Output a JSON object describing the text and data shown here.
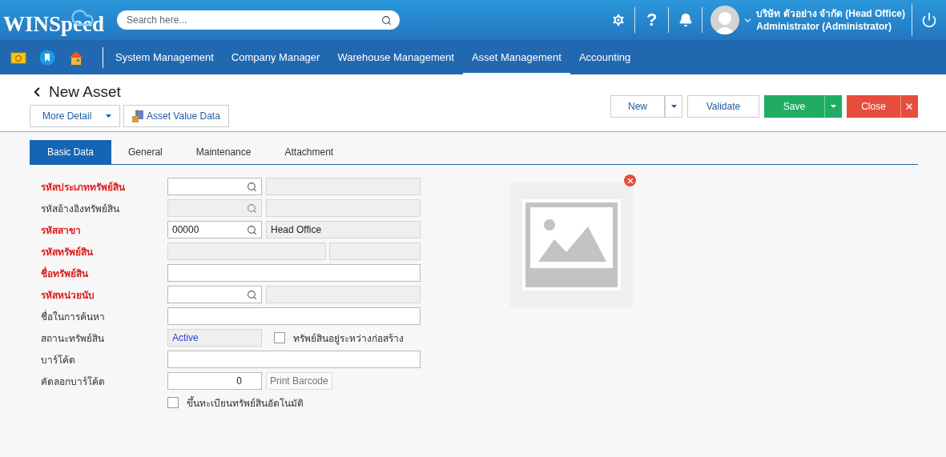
{
  "header": {
    "logo": "WINSpeed",
    "search": {
      "placeholder": "Search here..."
    },
    "help": "?",
    "company": "บริษัท ตัวอย่าง จำกัด (Head Office)",
    "user": "Administrator (Administrator)"
  },
  "menu": [
    {
      "label": "System Management",
      "selected": false
    },
    {
      "label": "Company Manager",
      "selected": false
    },
    {
      "label": "Warehouse Management",
      "selected": false
    },
    {
      "label": "Asset Management",
      "selected": true
    },
    {
      "label": "Accounting",
      "selected": false
    }
  ],
  "page": {
    "title": "New Asset",
    "more_detail": "More Detail",
    "asset_value": "Asset Value Data"
  },
  "actions": [
    {
      "label": "New",
      "kind": "secondary",
      "dropdown": true,
      "dismiss": false
    },
    {
      "label": "Validate",
      "kind": "secondary",
      "dropdown": false,
      "dismiss": false
    },
    {
      "label": "Save",
      "kind": "confirm",
      "dropdown": true,
      "dismiss": false
    },
    {
      "label": "Close",
      "kind": "cancel",
      "dropdown": false,
      "dismiss": true
    }
  ],
  "tabs": [
    {
      "label": "Basic Data",
      "selected": true
    },
    {
      "label": "General",
      "selected": false
    },
    {
      "label": "Maintenance",
      "selected": false
    },
    {
      "label": "Attachment",
      "selected": false
    }
  ],
  "form": [
    {
      "kind": "lookup",
      "label": "รหัสประเภททรัพย์สิน",
      "required": true,
      "disabled": false
    },
    {
      "kind": "lookup",
      "label": "รหัสอ้างอิงทรัพย์สิน",
      "required": false,
      "disabled": true
    },
    {
      "kind": "lookup",
      "label": "รหัสสาขา",
      "required": true,
      "disabled": false,
      "value": "00000",
      "description": "Head Office"
    },
    {
      "kind": "split",
      "label": "รหัสทรัพย์สิน",
      "required": true
    },
    {
      "kind": "text",
      "label": "ชื่อทรัพย์สิน",
      "required": true
    },
    {
      "kind": "lookup",
      "label": "รหัสหน่วยนับ",
      "required": true,
      "disabled": false
    },
    {
      "kind": "text",
      "label": "ชื่อในการค้นหา",
      "required": false
    },
    {
      "kind": "status",
      "label": "สถานะทรัพย์สิน",
      "required": false,
      "value": "Active",
      "checkbox": {
        "label": "ทรัพย์สินอยู่ระหว่างก่อสร้าง",
        "checked": false
      }
    },
    {
      "kind": "text",
      "label": "บาร์โค้ด",
      "required": false
    },
    {
      "kind": "copy",
      "label": "คัดลอกบาร์โค้ด",
      "required": false,
      "value": "0",
      "button": "Print Barcode"
    },
    {
      "kind": "check",
      "checkbox": {
        "label": "ขึ้นทะเบียนทรัพย์สินอัตโนมัติ",
        "checked": false
      }
    }
  ],
  "image": {
    "removable": true
  }
}
